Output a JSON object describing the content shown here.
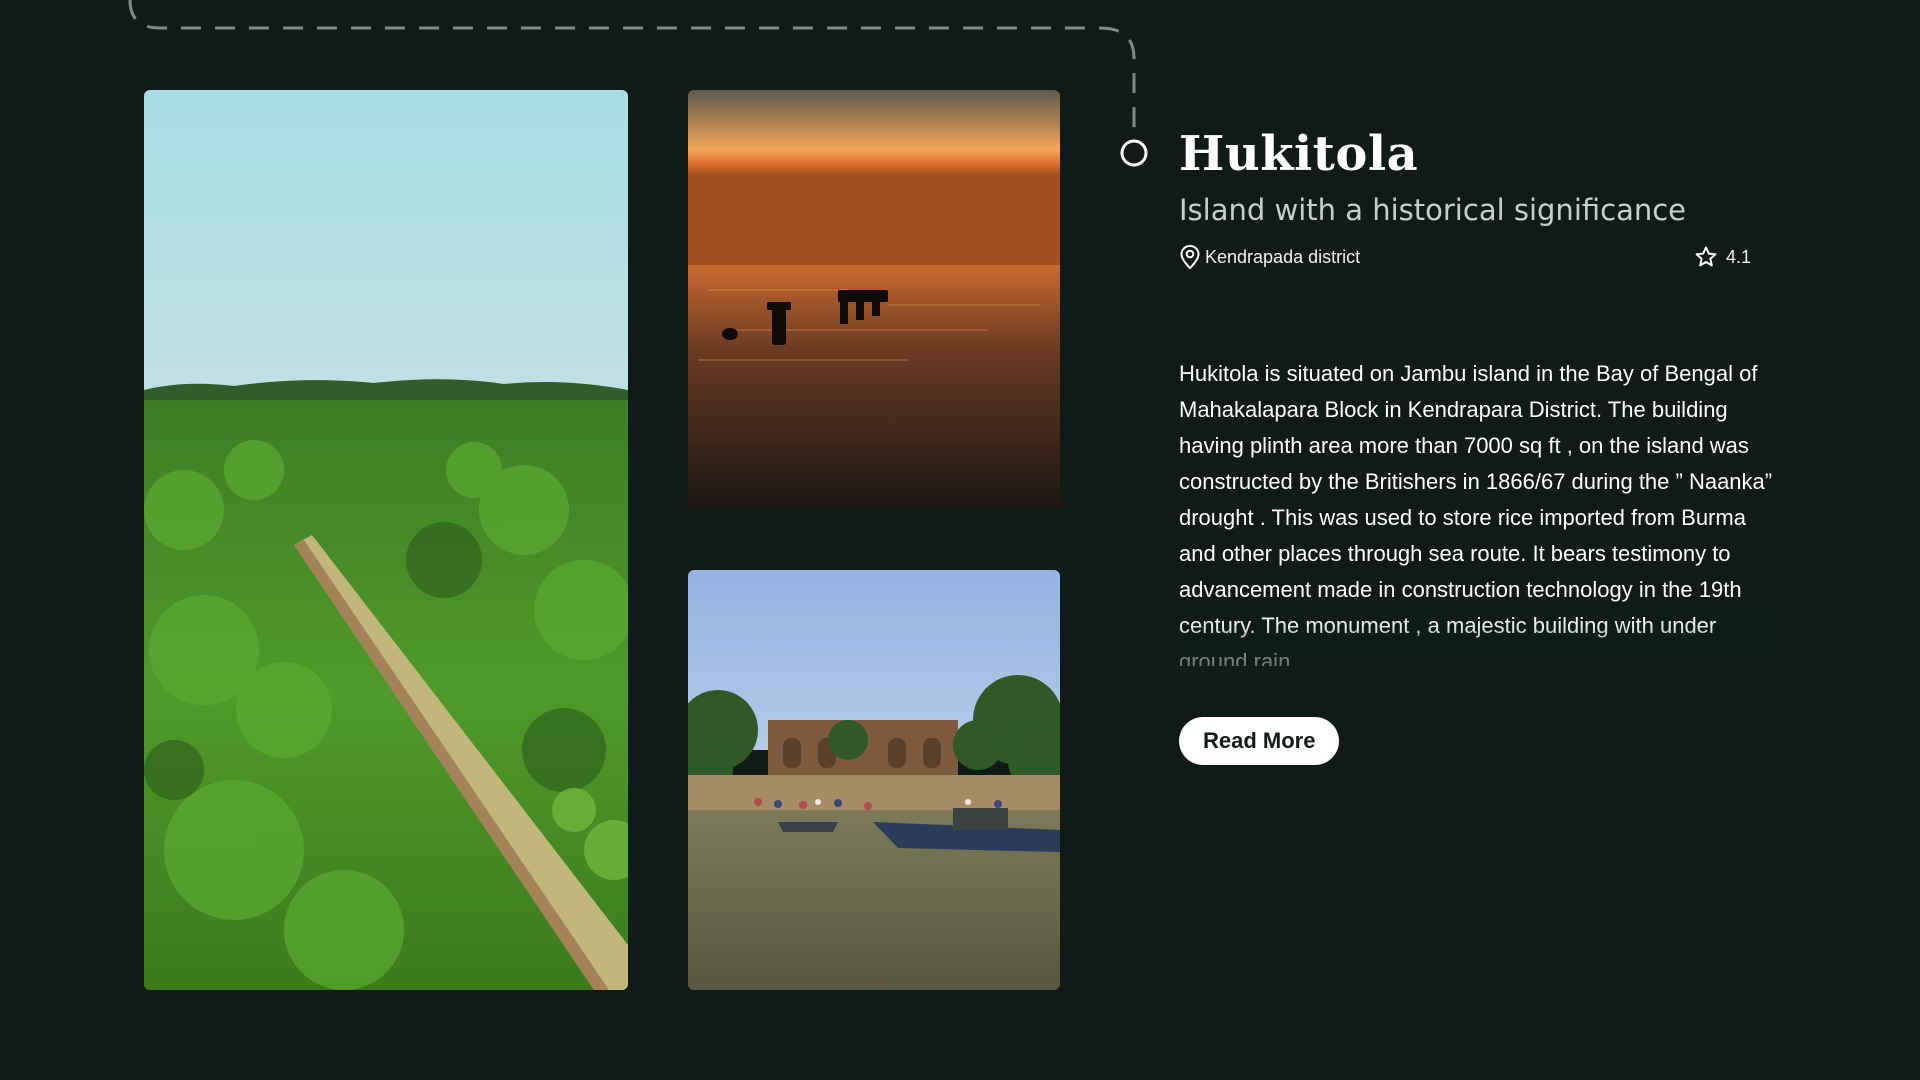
{
  "place": {
    "title": "Hukitola",
    "subtitle": "Island with a historical significance",
    "location": "Kendrapada district",
    "rating": "4.1"
  },
  "description": {
    "text": "Hukitola is situated on Jambu island in the Bay of Bengal of Mahakalapara Block in Kendrapara District. The building having plinth area more than 7000 sq ft , on the island was constructed by the Britishers in 1866/67 during the ” Naanka” drought . This was used to store rice imported from Burma and other places through sea route. It bears testimony to advancement made in construction technology in the 19th century.  The monument , a majestic building with under ground rain"
  },
  "actions": {
    "read_more_label": "Read More"
  },
  "icons": {
    "location": "map-pin-icon",
    "rating": "star-icon",
    "timeline": "timeline-node-icon"
  },
  "colors": {
    "background": "#101b17",
    "text": "#ffffff",
    "subtitle": "#c8cec9",
    "fade_text": "#3f7a68",
    "button_bg": "#ffffff",
    "button_text": "#101b17"
  }
}
